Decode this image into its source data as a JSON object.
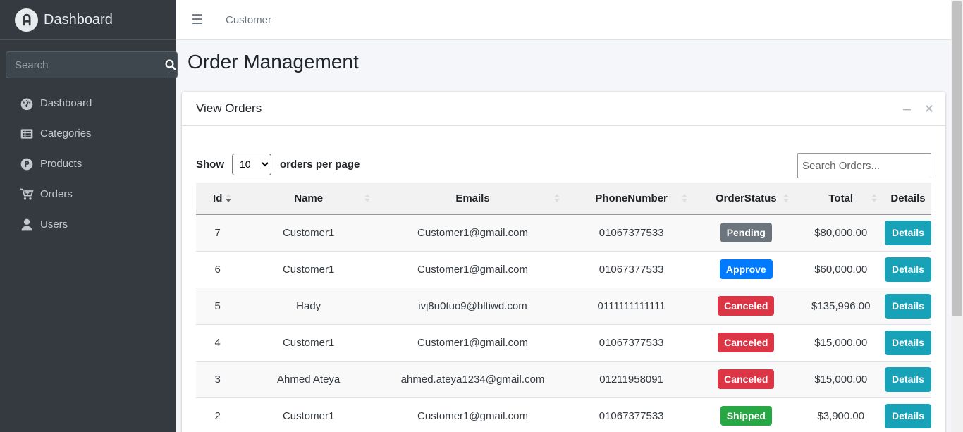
{
  "sidebar": {
    "brand": "Dashboard",
    "search_placeholder": "Search",
    "items": [
      {
        "label": "Dashboard",
        "icon": "tachometer-icon"
      },
      {
        "label": "Categories",
        "icon": "list-icon"
      },
      {
        "label": "Products",
        "icon": "product-p-icon"
      },
      {
        "label": "Orders",
        "icon": "cart-icon"
      },
      {
        "label": "Users",
        "icon": "user-icon"
      }
    ]
  },
  "topbar": {
    "link": "Customer"
  },
  "page": {
    "title": "Order Management"
  },
  "card": {
    "title": "View Orders",
    "show_label": "Show",
    "per_page_value": "10",
    "per_page_label": "orders per page",
    "search_placeholder": "Search Orders..."
  },
  "table": {
    "headers": [
      "Id",
      "Name",
      "Emails",
      "PhoneNumber",
      "OrderStatus",
      "Total",
      "Details"
    ],
    "rows": [
      {
        "id": "7",
        "name": "Customer1",
        "email": "Customer1@gmail.com",
        "phone": "01067377533",
        "status": "Pending",
        "total": "$80,000.00",
        "details": "Details"
      },
      {
        "id": "6",
        "name": "Customer1",
        "email": "Customer1@gmail.com",
        "phone": "01067377533",
        "status": "Approve",
        "total": "$60,000.00",
        "details": "Details"
      },
      {
        "id": "5",
        "name": "Hady",
        "email": "ivj8u0tuo9@bltiwd.com",
        "phone": "0111111111111",
        "status": "Canceled",
        "total": "$135,996.00",
        "details": "Details"
      },
      {
        "id": "4",
        "name": "Customer1",
        "email": "Customer1@gmail.com",
        "phone": "01067377533",
        "status": "Canceled",
        "total": "$15,000.00",
        "details": "Details"
      },
      {
        "id": "3",
        "name": "Ahmed Ateya",
        "email": "ahmed.ateya1234@gmail.com",
        "phone": "01211958091",
        "status": "Canceled",
        "total": "$15,000.00",
        "details": "Details"
      },
      {
        "id": "2",
        "name": "Customer1",
        "email": "Customer1@gmail.com",
        "phone": "01067377533",
        "status": "Shipped",
        "total": "$3,900.00",
        "details": "Details"
      }
    ]
  },
  "colors": {
    "sidebar_bg": "#343a40",
    "pending": "#6c757d",
    "approve": "#007bff",
    "canceled": "#dc3545",
    "shipped": "#28a745",
    "details_button": "#17a2b8"
  }
}
